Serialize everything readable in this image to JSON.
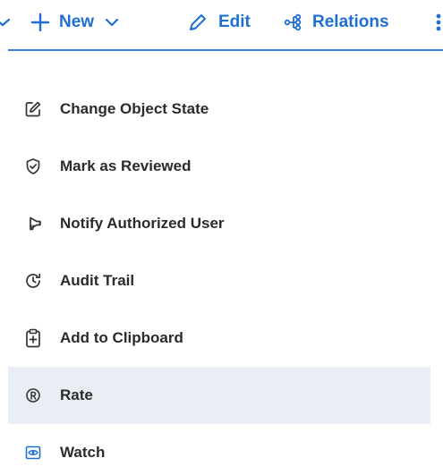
{
  "toolbar": {
    "new_label": "New",
    "edit_label": "Edit",
    "relations_label": "Relations"
  },
  "menu": {
    "items": [
      {
        "label": "Change Object State",
        "icon": "edit-square-icon"
      },
      {
        "label": "Mark as Reviewed",
        "icon": "shield-check-icon"
      },
      {
        "label": "Notify Authorized User",
        "icon": "megaphone-icon"
      },
      {
        "label": "Audit Trail",
        "icon": "history-icon"
      },
      {
        "label": "Add to Clipboard",
        "icon": "clipboard-plus-icon"
      },
      {
        "label": "Rate",
        "icon": "registered-circle-icon"
      },
      {
        "label": "Watch",
        "icon": "eye-box-icon"
      }
    ],
    "hovered_item": "Rate"
  },
  "colors": {
    "accent": "#1f6fd1",
    "menu_text": "#2b2b2b",
    "hover_background": "#e9eef4"
  }
}
